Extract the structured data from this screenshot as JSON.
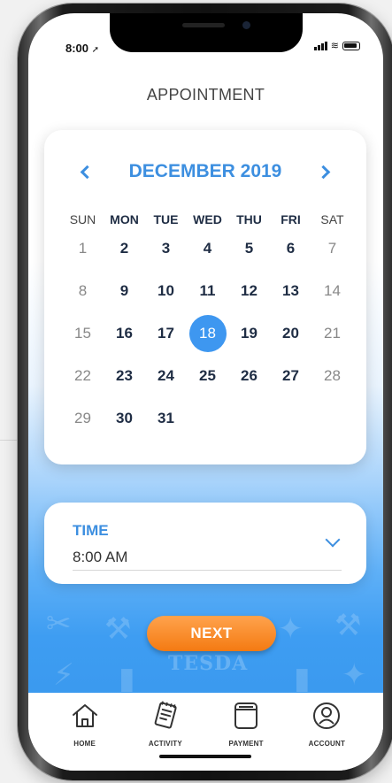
{
  "status_bar": {
    "time": "8:00"
  },
  "header": {
    "title": "APPOINTMENT"
  },
  "calendar": {
    "month_label": "DECEMBER 2019",
    "weekdays": [
      "SUN",
      "MON",
      "TUE",
      "WED",
      "THU",
      "FRI",
      "SAT"
    ],
    "weeks": [
      [
        "1",
        "2",
        "3",
        "4",
        "5",
        "6",
        "7"
      ],
      [
        "8",
        "9",
        "10",
        "11",
        "12",
        "13",
        "14"
      ],
      [
        "15",
        "16",
        "17",
        "18",
        "19",
        "20",
        "21"
      ],
      [
        "22",
        "23",
        "24",
        "25",
        "26",
        "27",
        "28"
      ],
      [
        "29",
        "30",
        "31",
        "",
        "",
        "",
        ""
      ]
    ],
    "selected_day": "18"
  },
  "time_field": {
    "label": "TIME",
    "value": "8:00 AM"
  },
  "next_button": {
    "label": "NEXT"
  },
  "background": {
    "watermark": "TESDA"
  },
  "bottom_nav": [
    {
      "label": "HOME",
      "icon": "home-icon"
    },
    {
      "label": "ACTIVITY",
      "icon": "activity-icon"
    },
    {
      "label": "PAYMENT",
      "icon": "payment-icon"
    },
    {
      "label": "ACCOUNT",
      "icon": "account-icon"
    }
  ],
  "colors": {
    "accent": "#3D8FE0",
    "selected_day": "#3E97F0",
    "button_orange": "#F47A12",
    "background_blue": "#3A99EE"
  }
}
